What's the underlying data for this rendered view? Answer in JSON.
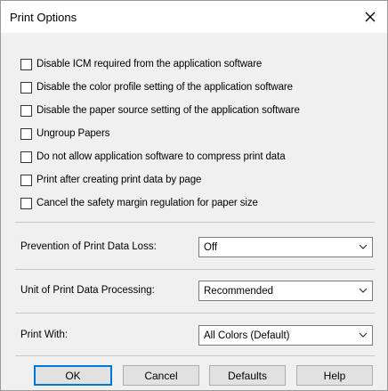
{
  "window": {
    "title": "Print Options",
    "close_symbol": "✕"
  },
  "options": [
    {
      "label": "Disable ICM required from the application software",
      "checked": false
    },
    {
      "label": "Disable the color profile setting of the application software",
      "checked": false
    },
    {
      "label": "Disable the paper source setting of the application software",
      "checked": false
    },
    {
      "label": "Ungroup Papers",
      "checked": false
    },
    {
      "label": "Do not allow application software to compress print data",
      "checked": false
    },
    {
      "label": "Print after creating print data by page",
      "checked": false
    },
    {
      "label": "Cancel the safety margin regulation for paper size",
      "checked": false
    }
  ],
  "settings": {
    "prevention": {
      "label": "Prevention of Print Data Loss:",
      "value": "Off"
    },
    "unit": {
      "label": "Unit of Print Data Processing:",
      "value": "Recommended"
    },
    "print_with": {
      "label": "Print With:",
      "value": "All Colors (Default)"
    }
  },
  "buttons": {
    "ok": "OK",
    "cancel": "Cancel",
    "defaults": "Defaults",
    "help": "Help"
  },
  "colors": {
    "dialog_background": "#f0f0f0",
    "default_button_border": "#0078d7"
  }
}
